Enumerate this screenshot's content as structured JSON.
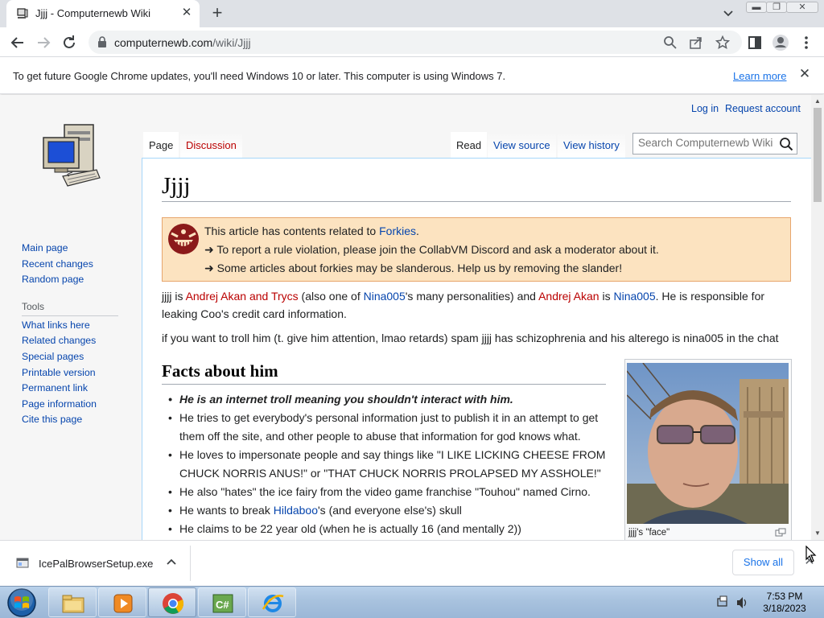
{
  "browser": {
    "tab_title": "Jjjj - Computernewb Wiki",
    "url_host": "computernewb.com",
    "url_path": "/wiki/Jjjj",
    "infobar_message": "To get future Google Chrome updates, you'll need Windows 10 or later. This computer is using Windows 7.",
    "infobar_link": "Learn more"
  },
  "wiki": {
    "personal": {
      "login": "Log in",
      "request": "Request account"
    },
    "tabs": {
      "page": "Page",
      "discussion": "Discussion",
      "read": "Read",
      "view_source": "View source",
      "view_history": "View history"
    },
    "search_placeholder": "Search Computernewb Wiki",
    "nav": {
      "main": [
        "Main page",
        "Recent changes",
        "Random page"
      ],
      "tools_heading": "Tools",
      "tools": [
        "What links here",
        "Related changes",
        "Special pages",
        "Printable version",
        "Permanent link",
        "Page information",
        "Cite this page"
      ]
    },
    "title": "Jjjj",
    "notice": {
      "line1_pre": "This article has contents related to ",
      "line1_link": "Forkies",
      "line1_post": ".",
      "line2": "➜ To report a rule violation, please join the CollabVM Discord and ask a moderator about it.",
      "line3": "➜ Some articles about forkies may be slanderous. Help us by removing the slander!"
    },
    "intro": {
      "t1": "jjjj is ",
      "struck": "Andrej Akan and",
      "trycs": "Trycs",
      "t2": " (also one of ",
      "nina1": "Nina005",
      "t3": "'s many personalities) and ",
      "andrej": "Andrej Akan",
      "t4": " is ",
      "nina2": "Nina005",
      "t5": ". He is responsible for leaking Coo's credit card information."
    },
    "para2": "if you want to troll him (t. give him attention, lmao retards) spam jjjj has schizophrenia and his alterego is nina005 in the chat",
    "facts_heading": "Facts about him",
    "facts": {
      "f1": "He is an internet troll meaning you shouldn't interact with him.",
      "f2": "He tries to get everybody's personal information just to publish it in an attempt to get them off the site, and other people to abuse that information for god knows what.",
      "f3": "He loves to impersonate people and say things like \"I LIKE LICKING CHEESE FROM CHUCK NORRIS ANUS!\" or \"THAT CHUCK NORRIS PROLAPSED MY ASSHOLE!\"",
      "f4": "He also \"hates\" the ice fairy from the video game franchise \"Touhou\" named Cirno.",
      "f5_pre": "He wants to break ",
      "f5_link": "Hildaboo",
      "f5_post": "'s (and everyone else's) skull",
      "f6": "He claims to be 22 year old (when he is actually 16 (and mentally 2))"
    },
    "thumb_caption": "jjjj's \"face\""
  },
  "download": {
    "filename": "IcePalBrowserSetup.exe",
    "show_all": "Show all"
  },
  "taskbar": {
    "time": "7:53 PM",
    "date": "3/18/2023"
  },
  "colors": {
    "link": "#0645ad",
    "redlink": "#ba0000",
    "notice_bg": "#fce3c0",
    "chrome_accent": "#1a73e8"
  }
}
